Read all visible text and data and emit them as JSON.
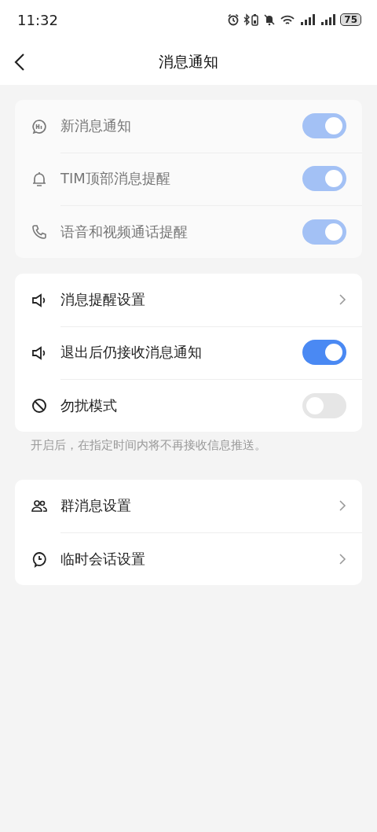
{
  "status_bar": {
    "time": "11:32",
    "battery": "75"
  },
  "header": {
    "title": "消息通知"
  },
  "sections": [
    {
      "disabled": true,
      "items": [
        {
          "kind": "toggle",
          "label": "新消息通知",
          "on": true
        },
        {
          "kind": "toggle",
          "label": "TIM顶部消息提醒",
          "on": true
        },
        {
          "kind": "toggle",
          "label": "语音和视频通话提醒",
          "on": true
        }
      ]
    },
    {
      "disabled": false,
      "items": [
        {
          "kind": "link",
          "label": "消息提醒设置"
        },
        {
          "kind": "toggle",
          "label": "退出后仍接收消息通知",
          "on": true
        },
        {
          "kind": "toggle",
          "label": "勿扰模式",
          "on": false
        }
      ],
      "note": "开启后，在指定时间内将不再接收信息推送。"
    },
    {
      "disabled": false,
      "items": [
        {
          "kind": "link",
          "label": "群消息设置"
        },
        {
          "kind": "link",
          "label": "临时会话设置"
        }
      ]
    }
  ]
}
